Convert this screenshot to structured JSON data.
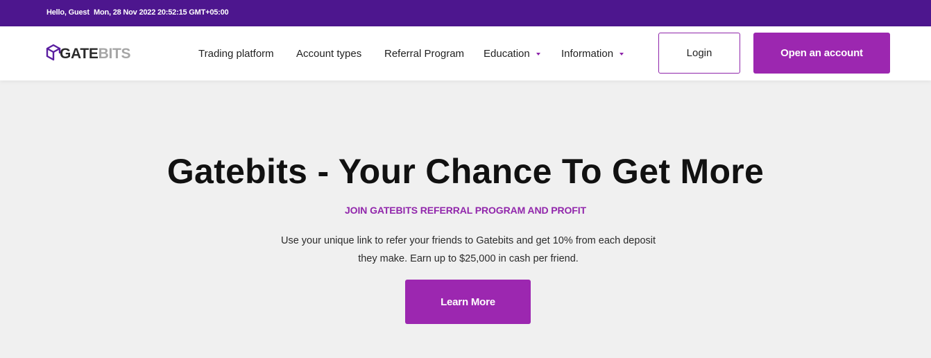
{
  "topbar": {
    "greeting": "Hello, Guest",
    "datetime": "Mon, 28 Nov 2022 20:52:15 GMT+05:00"
  },
  "header": {
    "logo": {
      "word_primary": "GATE",
      "word_secondary": "BITS",
      "icon": "cube-icon"
    },
    "nav": [
      {
        "label": "Trading platform",
        "has_dropdown": false
      },
      {
        "label": "Account types",
        "has_dropdown": false
      },
      {
        "label": "Referral Program",
        "has_dropdown": false
      },
      {
        "label": "Education",
        "has_dropdown": true
      },
      {
        "label": "Information",
        "has_dropdown": true
      }
    ],
    "login_label": "Login",
    "open_account_label": "Open an account"
  },
  "hero": {
    "title": "Gatebits - Your Chance To Get More",
    "subtitle": "JOIN GATEBITS REFERRAL PROGRAM AND PROFIT",
    "description": "Use your unique link to refer your friends to Gatebits and get 10% from each deposit they make. Earn up to $25,000 in cash per friend.",
    "cta_label": "Learn More"
  },
  "colors": {
    "topbar_bg": "#4d168e",
    "accent": "#9c27b0",
    "page_bg": "#f0f0f0"
  }
}
